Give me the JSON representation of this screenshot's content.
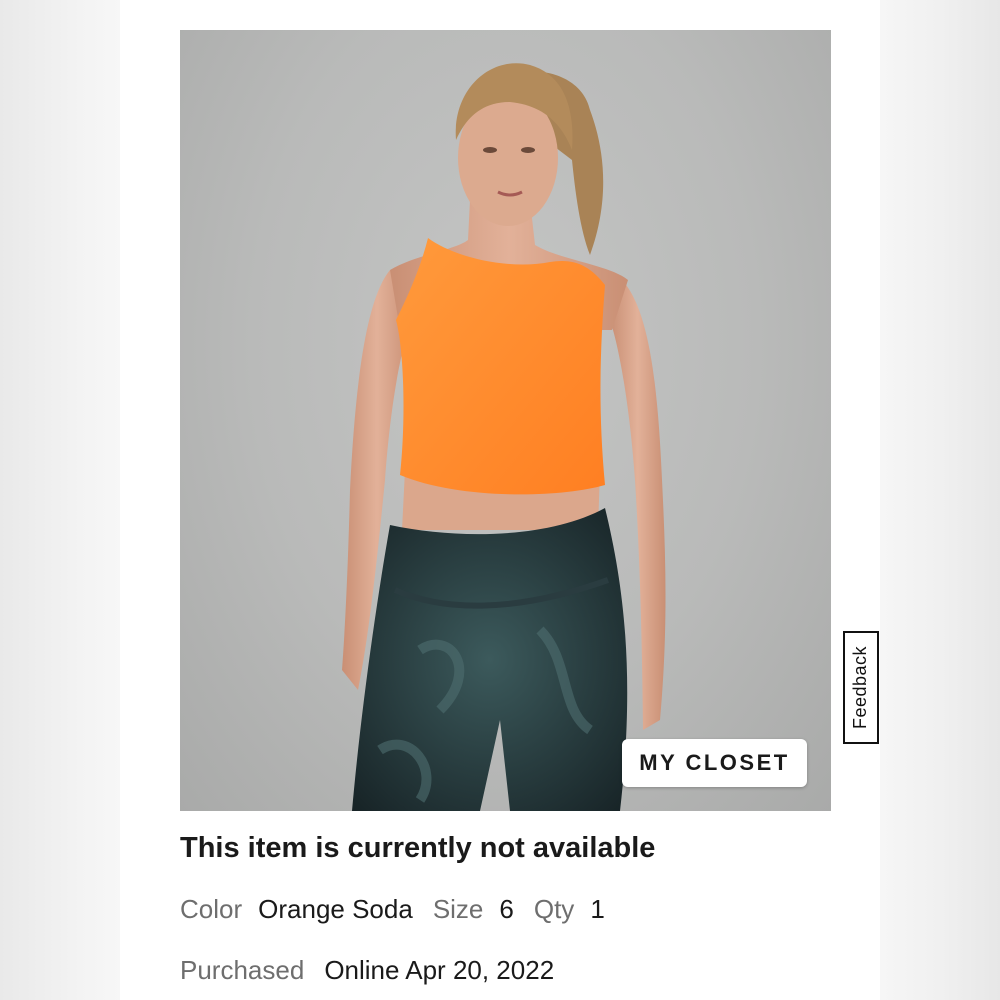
{
  "product": {
    "image": {
      "alt": "Model wearing orange cropped tank top and dark tie-dye leggings",
      "colors": {
        "background": "#bdbebd",
        "top": "#ff8a2a",
        "leggings": "#1f2e33",
        "skin": "#dba78c",
        "hair": "#b38b5b"
      }
    },
    "closet_button_label": "MY CLOSET",
    "status": "This item is currently not available",
    "color_label": "Color",
    "color_value": "Orange Soda",
    "size_label": "Size",
    "size_value": "6",
    "qty_label": "Qty",
    "qty_value": "1",
    "purchased_label": "Purchased",
    "purchased_value": "Online Apr 20, 2022"
  },
  "feedback_label": "Feedback"
}
